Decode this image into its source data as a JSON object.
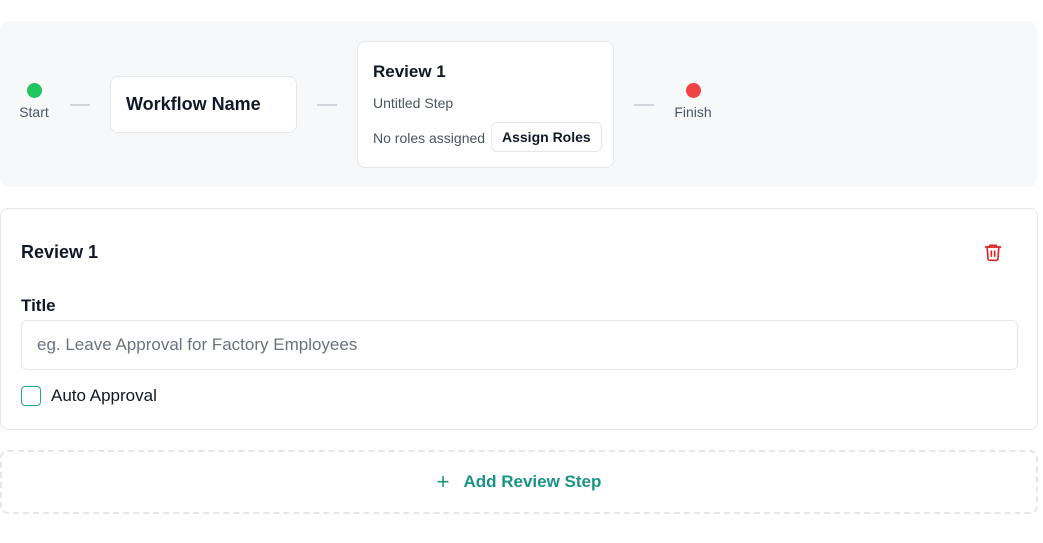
{
  "workflow": {
    "start_label": "Start",
    "finish_label": "Finish",
    "name_card": "Workflow Name",
    "step_card": {
      "title": "Review 1",
      "subtitle": "Untitled Step",
      "roles_text": "No roles assigned",
      "assign_button": "Assign Roles"
    }
  },
  "review_panel": {
    "title": "Review 1",
    "title_field_label": "Title",
    "title_input_value": "",
    "title_input_placeholder": "eg. Leave Approval for Factory Employees",
    "auto_approval_label": "Auto Approval",
    "auto_approval_checked": false,
    "delete_icon": "trash-icon"
  },
  "add_step": {
    "icon": "plus-icon",
    "label": "Add Review Step"
  },
  "colors": {
    "start_dot": "#22c55e",
    "finish_dot": "#ef4444",
    "accent": "#1a9385",
    "danger": "#dc2626",
    "strip_background": "#f7f8fa"
  }
}
